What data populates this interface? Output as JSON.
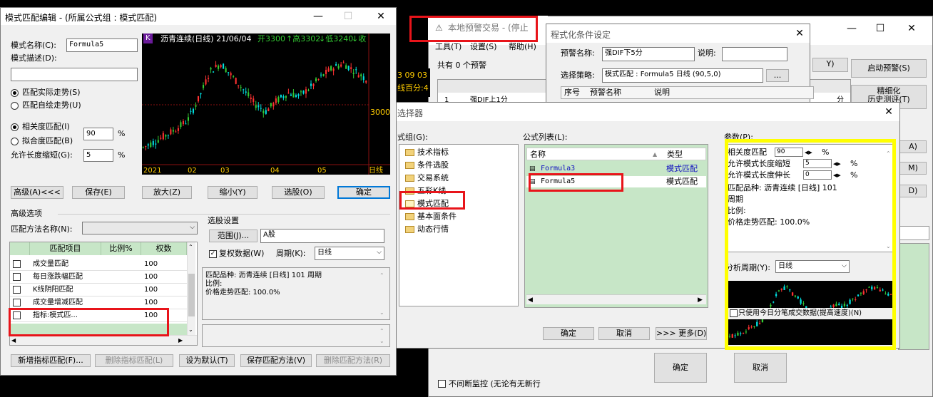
{
  "background_window": {
    "toolbar": [
      "工具(T)",
      "设置(S)",
      "帮助(H)"
    ],
    "alert_count": "共有 0 个预警",
    "row_prefix": "1",
    "row_name": "强DIF上1分",
    "row_trail": "分",
    "time_text": "3 09 03",
    "pct_text": "线百分:4",
    "right_buttons": [
      "Y)",
      "启动预警(S)",
      "精细化",
      "历史测评(T)"
    ],
    "side_letters": [
      "A)",
      "M)",
      "D)"
    ],
    "bottom_buttons": [
      "确定",
      "取消"
    ],
    "bottom_check": "不间断监控 (无论有无新行",
    "window_controls": [
      "—",
      "☐",
      "✕"
    ]
  },
  "local_alert_window": {
    "title": "本地预警交易 - (停止"
  },
  "condition_window": {
    "title": "程式化条件设定",
    "alert_name_label": "预警名称:",
    "alert_name_value": "强DIF下5分",
    "desc_label": "说明:",
    "strategy_label": "选择策略:",
    "strategy_value": "模式匹配 : Formula5 日线 (90,5,0)",
    "dots_button": "...",
    "table_headers": [
      "序号",
      "预警名称",
      "说明"
    ]
  },
  "selector_window": {
    "title": "选择器",
    "group_label": "式组(G):",
    "formula_list_label": "公式列表(L):",
    "params_label": "参数(P):",
    "groups": [
      "技术指标",
      "条件选股",
      "交易系统",
      "五彩K线",
      "模式匹配",
      "基本面条件",
      "动态行情"
    ],
    "list_headers": [
      "名称",
      "类型"
    ],
    "formulas": [
      {
        "name": "Formula3",
        "type": "模式匹配"
      },
      {
        "name": "Formula5",
        "type": "模式匹配"
      }
    ],
    "params": [
      {
        "label": "相关度匹配",
        "value": "90",
        "unit": "%"
      },
      {
        "label": "允许模式长度缩短",
        "value": "5",
        "unit": "%"
      },
      {
        "label": "允许模式长度伸长",
        "value": "0",
        "unit": "%"
      }
    ],
    "param_lines": [
      "匹配品种: 沥青连续 [日线] 101",
      "周期",
      "比例:",
      "价格走势匹配: 100.0%"
    ],
    "period_label": "分析周期(Y):",
    "period_value": "日线",
    "fast_check": "只使用今日分笔成交数据(提高速度)(N)",
    "buttons": [
      "确定",
      "取消",
      ">>> 更多(D)"
    ]
  },
  "pattern_editor": {
    "title": "模式匹配编辑 - (所属公式组 : 模式匹配)",
    "name_label": "模式名称(C):",
    "name_value": "Formula5",
    "desc_label": "模式描述(D):",
    "desc_value": "",
    "radio_actual": "匹配实际走势(S)",
    "radio_self": "匹配自绘走势(U)",
    "radio_corr": "相关度匹配(I)",
    "corr_value": "90",
    "radio_fit": "拟合度匹配(B)",
    "shorten_label": "允许长度缩短(G):",
    "shorten_value": "5",
    "pct": "%",
    "buttons": [
      "高级(A)<<<",
      "保存(E)",
      "放大(Z)",
      "缩小(Y)",
      "选股(O)",
      "确定"
    ],
    "advanced_label": "高级选项",
    "method_label": "匹配方法名称(N):",
    "method_value": "",
    "grid_headers": [
      "匹配项目",
      "比例%",
      "权数"
    ],
    "grid_rows": [
      {
        "item": "成交量匹配",
        "ratio": "",
        "weight": "100"
      },
      {
        "item": "每日涨跌幅匹配",
        "ratio": "",
        "weight": "100"
      },
      {
        "item": "K线阴阳匹配",
        "ratio": "",
        "weight": "100"
      },
      {
        "item": "成交量增减匹配",
        "ratio": "",
        "weight": "100"
      },
      {
        "item": "指标:模式匹...",
        "ratio": "",
        "weight": "100"
      }
    ],
    "stock_settings_label": "选股设置",
    "range_button": "范围(J)...",
    "range_value": "A股",
    "adjust_check": "复权数据(W)",
    "cycle_label": "周期(K):",
    "cycle_value": "日线",
    "summary_lines": [
      "匹配品种: 沥青连续 [日线] 101 周期",
      "比例:",
      "价格走势匹配: 100.0%"
    ],
    "bottom_buttons": [
      "新增指标匹配(F)...",
      "删除指标匹配(L)",
      "设为默认(T)",
      "保存匹配方法(V)",
      "删除匹配方法(R)"
    ],
    "window_controls": [
      "—",
      "☐",
      "✕"
    ]
  },
  "chart_header": {
    "k": "K",
    "name": "沥青连续(日线) 21/06/04",
    "open": "开3300",
    "high": "↑高3302",
    "low": "↓低3240",
    "close": "↓收",
    "price_label": "3000",
    "x_labels": [
      "2021",
      "02",
      "03",
      "04",
      "05",
      "日线"
    ]
  },
  "chart_data": {
    "type": "candlestick",
    "title": "沥青连续(日线) 21/06/04",
    "x_ticks": [
      "2021",
      "02",
      "03",
      "04",
      "05"
    ],
    "y_ticks": [
      3000
    ],
    "approx_close_path": [
      2650,
      2700,
      2760,
      2820,
      2900,
      3100,
      3350,
      3420,
      3300,
      3180,
      3050,
      2980,
      3080,
      3150,
      3120,
      3200,
      3300,
      3380,
      3420,
      3350,
      3280
    ],
    "colors": {
      "up": "#ff3232",
      "down": "#00e1e1",
      "even": "#33cc33"
    }
  },
  "colors": {
    "highlight_red": "#e8141a",
    "highlight_yellow": "#ffff00",
    "grid_green": "#c7e6c7",
    "chart_bg": "#000000"
  }
}
